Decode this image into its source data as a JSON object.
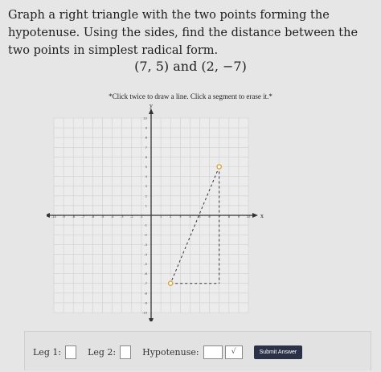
{
  "problem_text": "Graph a right triangle with the two points forming the hypotenuse. Using the sides, find the distance between the two points in simplest radical form.",
  "points_text": "(7, 5) and (2, −7)",
  "instruction": "*Click twice to draw a line. Click a segment to erase it.*",
  "graph": {
    "x_axis_label": "x",
    "y_axis_label": "y",
    "range": [
      -10,
      10
    ],
    "point_a": [
      7,
      5
    ],
    "point_b": [
      2,
      -7
    ],
    "tick_labels_x": [
      "-10",
      "-9",
      "-8",
      "-7",
      "-6",
      "-5",
      "-4",
      "-3",
      "-2",
      "-1",
      "1",
      "2",
      "3",
      "4",
      "5",
      "6",
      "7",
      "8",
      "9",
      "10"
    ],
    "tick_labels_y": [
      "10",
      "9",
      "8",
      "7",
      "6",
      "5",
      "4",
      "3",
      "2",
      "1",
      "-1",
      "-2",
      "-3",
      "-4",
      "-5",
      "-6",
      "-7",
      "-8",
      "-9",
      "-10"
    ],
    "point_color": "#d9a23a"
  },
  "answer": {
    "leg1_label": "Leg 1:",
    "leg2_label": "Leg 2:",
    "hypotenuse_label": "Hypotenuse:",
    "sqrt_symbol": "√",
    "submit_label": "Submit Answer"
  }
}
